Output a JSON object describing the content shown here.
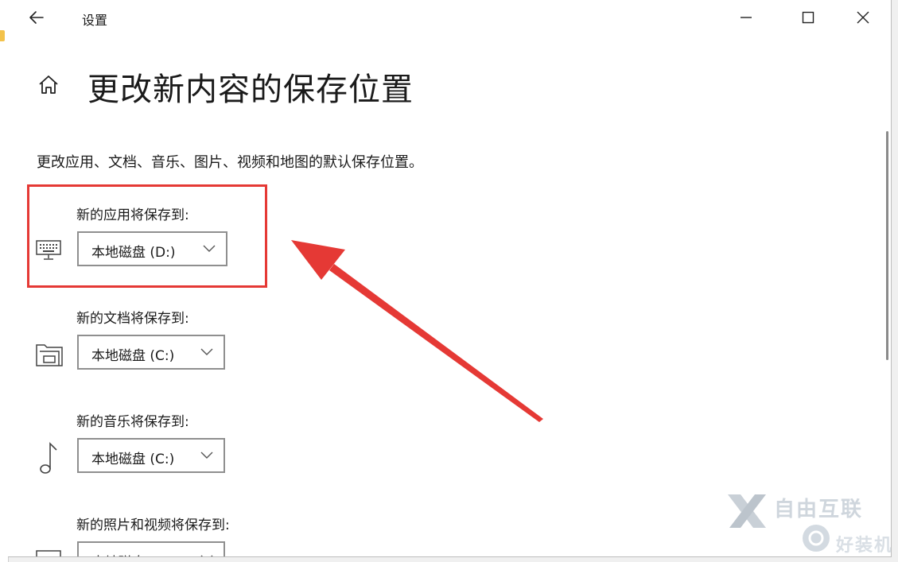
{
  "window": {
    "title": "设置"
  },
  "page": {
    "title": "更改新内容的保存位置",
    "description": "更改应用、文档、音乐、图片、视频和地图的默认保存位置。"
  },
  "settings": [
    {
      "label": "新的应用将保存到:",
      "value": "本地磁盘 (D:)",
      "icon": "keyboard-icon"
    },
    {
      "label": "新的文档将保存到:",
      "value": "本地磁盘 (C:)",
      "icon": "documents-folder-icon"
    },
    {
      "label": "新的音乐将保存到:",
      "value": "本地磁盘 (C:)",
      "icon": "music-note-icon"
    },
    {
      "label": "新的照片和视频将保存到:",
      "value": "本地磁盘 (C:)",
      "icon": "photo-monitor-icon"
    }
  ],
  "annotation": {
    "color": "#e53935"
  },
  "watermark": {
    "brand": "自由互联",
    "sub": "好装机"
  }
}
